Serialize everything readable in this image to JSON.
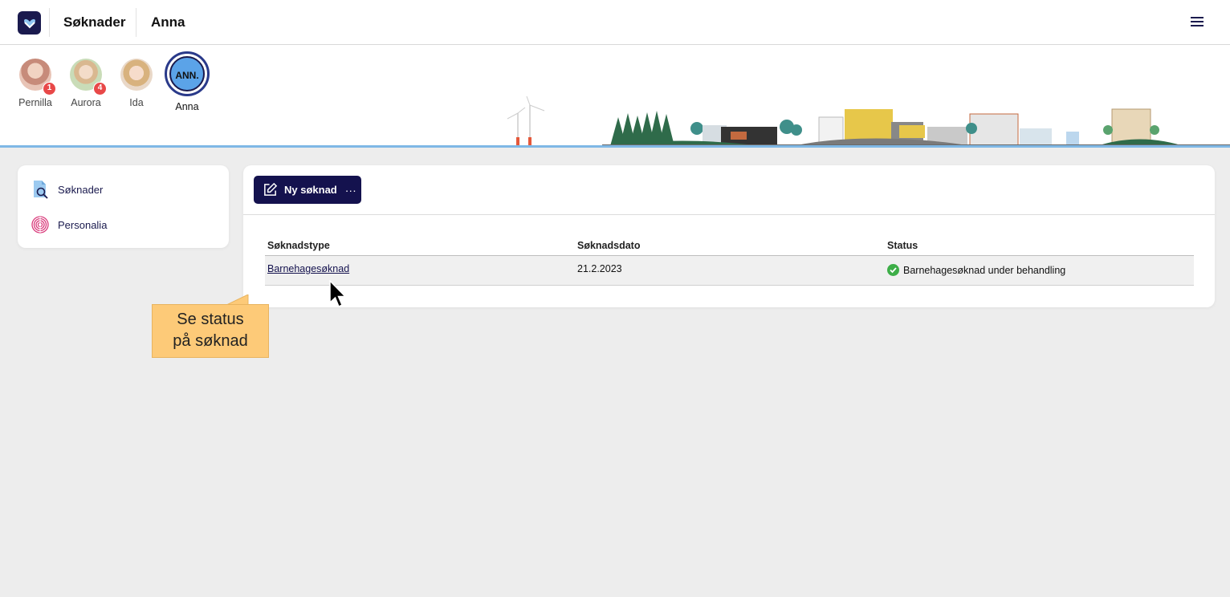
{
  "topbar": {
    "app_title": "Søknader",
    "user_title": "Anna",
    "menu_icon": "hamburger-menu-icon"
  },
  "profiles": [
    {
      "name": "Pernilla",
      "badge": "1"
    },
    {
      "name": "Aurora",
      "badge": "4"
    },
    {
      "name": "Ida",
      "badge": ""
    },
    {
      "name": "Anna",
      "initials": "ANN.",
      "active": true
    }
  ],
  "sidebar": {
    "items": [
      {
        "label": "Søknader",
        "icon": "document-search-icon"
      },
      {
        "label": "Personalia",
        "icon": "fingerprint-icon"
      }
    ]
  },
  "main": {
    "new_button": {
      "label": "Ny søknad",
      "more": "···",
      "icon": "edit-icon"
    },
    "table": {
      "headers": [
        "Søknadstype",
        "Søknadsdato",
        "Status"
      ],
      "rows": [
        {
          "type": "Barnehagesøknad",
          "date": "21.2.2023",
          "status": "Barnehagesøknad under behandling"
        }
      ]
    }
  },
  "callout": {
    "line1": "Se status",
    "line2": "på søknad"
  },
  "colors": {
    "primary": "#14124e",
    "accent_blue": "#5ba3e8",
    "badge_red": "#e84848",
    "status_green": "#3dae48",
    "callout_yellow": "#fdca78"
  }
}
